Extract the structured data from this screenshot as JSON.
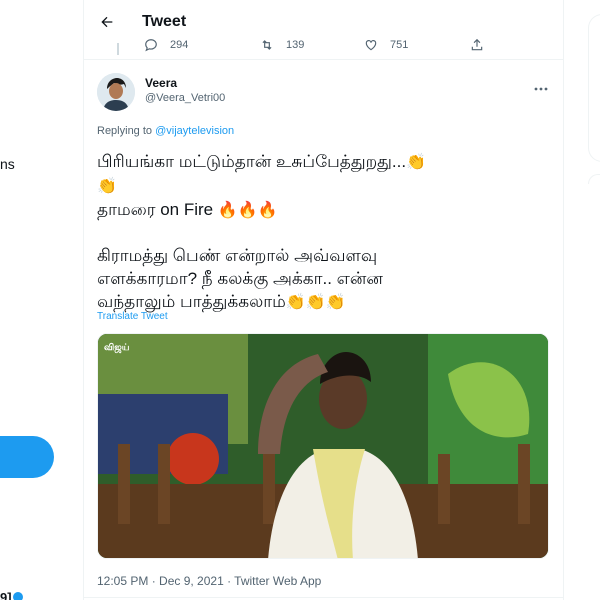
{
  "left": {
    "nav_fragment": "ns",
    "bottom_fragment": "9]"
  },
  "header": {
    "back_icon": "arrow-left-icon",
    "title": "Tweet"
  },
  "previous_tweet": {
    "reply_count": "294",
    "retweet_count": "139",
    "like_count": "751"
  },
  "tweet": {
    "author_name": "Veera",
    "author_handle": "@Veera_Vetri00",
    "replying_prefix": "Replying to",
    "replying_to": "@vijaytelevision",
    "lines": [
      {
        "text": "பிரியங்கா மட்டும்தான் உசுப்பேத்துறது...",
        "emoji": "👏"
      },
      {
        "text": "",
        "emoji": "👏"
      },
      {
        "text": "தாமரை on Fire ",
        "emoji": "🔥🔥🔥"
      },
      {
        "text": "",
        "emoji": ""
      },
      {
        "text": "கிராமத்து பெண் என்றால் அவ்வளவு",
        "emoji": ""
      },
      {
        "text": "எளக்காரமா? நீ கலக்கு அக்கா.. என்ன",
        "emoji": ""
      },
      {
        "text": "வந்தாலும் பாத்துக்கலாம்",
        "emoji": "👏👏👏"
      }
    ],
    "translate_label": "Translate Tweet",
    "media_badge": "விஜய்",
    "timestamp": "12:05 PM · Dec 9, 2021 · Twitter Web App"
  }
}
